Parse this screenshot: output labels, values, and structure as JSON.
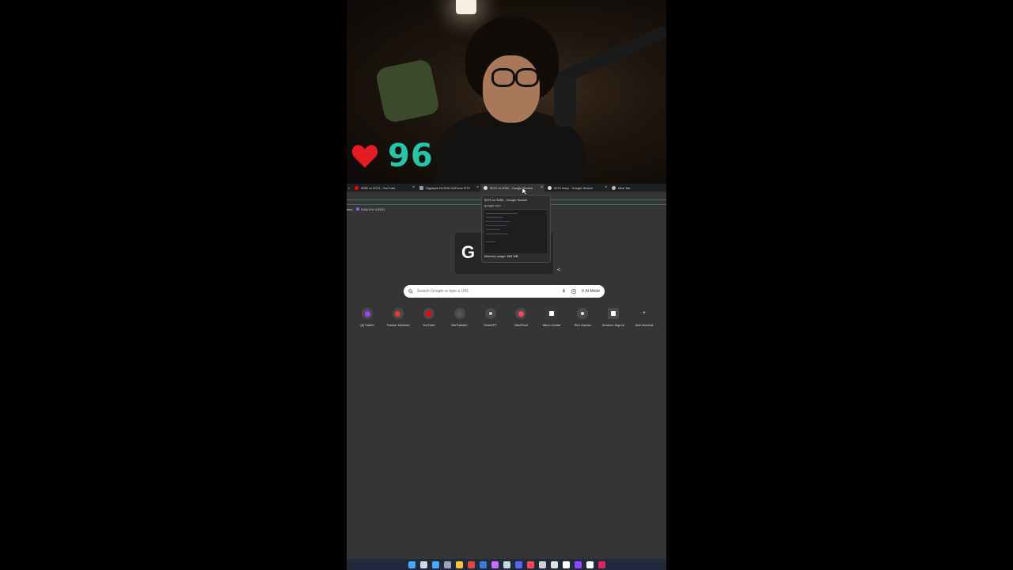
{
  "overlay": {
    "heart_rate": "96",
    "colors": {
      "heart": "#e31b23",
      "number": "#27c4a8"
    }
  },
  "tabs": [
    {
      "label": "3080 vs 5070 - YouTube",
      "icon": "youtube-icon",
      "color": "#ff0000"
    },
    {
      "label": "Gigabyte NVIDIA GeForce RTX",
      "icon": "gigabyte-icon",
      "color": "#9a9a9a"
    },
    {
      "label": "5070 vs 3080 - Google Search",
      "icon": "google-icon",
      "color": "#dcdcdc"
    },
    {
      "label": "5070 msrp - Google Search",
      "icon": "google-icon",
      "color": "#dcdcdc"
    },
    {
      "label": "New Tab",
      "icon": "chrome-icon",
      "color": "#bbbbbb"
    }
  ],
  "bookmarks": {
    "left_fragment": "arks",
    "item": "PUBLISH VIDEO"
  },
  "hovercard": {
    "title": "5070 vs 3080 - Google Search",
    "url": "google.com",
    "memory": "Memory usage: 882 MB"
  },
  "search": {
    "placeholder": "Search Google or type a URL",
    "ai_mode": "AI Mode"
  },
  "shortcuts": [
    {
      "label": "(5) Twitch",
      "icon": "twitch-icon",
      "color": "#9146ff"
    },
    {
      "label": "Tracker Network",
      "icon": "tracker-network-icon",
      "color": "#e53935"
    },
    {
      "label": "YouTube",
      "icon": "youtube-icon",
      "color": "#ff0000"
    },
    {
      "label": "WeTransfer",
      "icon": "wetransfer-icon",
      "color": "#555555"
    },
    {
      "label": "ChatGPT",
      "icon": "chatgpt-icon",
      "color": "#cccccc"
    },
    {
      "label": "ValoPlant",
      "icon": "valoplant-icon",
      "color": "#ff4655"
    },
    {
      "label": "Micro Center",
      "icon": "micro-center-icon",
      "color": "#ffffff"
    },
    {
      "label": "Riot Games",
      "icon": "riot-games-icon",
      "color": "#eaeaea"
    },
    {
      "label": "Amazon Sign-in",
      "icon": "amazon-icon",
      "color": "#ffffff"
    },
    {
      "label": "Add shortcut",
      "icon": "plus-icon",
      "color": "#ffffff"
    }
  ],
  "taskbar": [
    {
      "icon": "windows-start-icon",
      "color": "#4aa3ff"
    },
    {
      "icon": "task-view-icon",
      "color": "#cfd6e4"
    },
    {
      "icon": "photos-icon",
      "color": "#49a8ff"
    },
    {
      "icon": "settings-icon",
      "color": "#9aa6b8"
    },
    {
      "icon": "file-explorer-icon",
      "color": "#f5c542"
    },
    {
      "icon": "chrome-icon",
      "color": "#e8453c"
    },
    {
      "icon": "app-icon",
      "color": "#3d7bd9"
    },
    {
      "icon": "messenger-icon",
      "color": "#c86dff"
    },
    {
      "icon": "steam-icon",
      "color": "#c7d5e0"
    },
    {
      "icon": "discord-icon",
      "color": "#5865f2"
    },
    {
      "icon": "valorant-icon",
      "color": "#ff4655"
    },
    {
      "icon": "app-icon",
      "color": "#d0d0d0"
    },
    {
      "icon": "obs-icon",
      "color": "#e0e0e0"
    },
    {
      "icon": "app-icon",
      "color": "#ffffff"
    },
    {
      "icon": "twitch-icon",
      "color": "#9146ff"
    },
    {
      "icon": "app-icon",
      "color": "#ffffff"
    },
    {
      "icon": "app-icon",
      "color": "#e0245e"
    }
  ]
}
